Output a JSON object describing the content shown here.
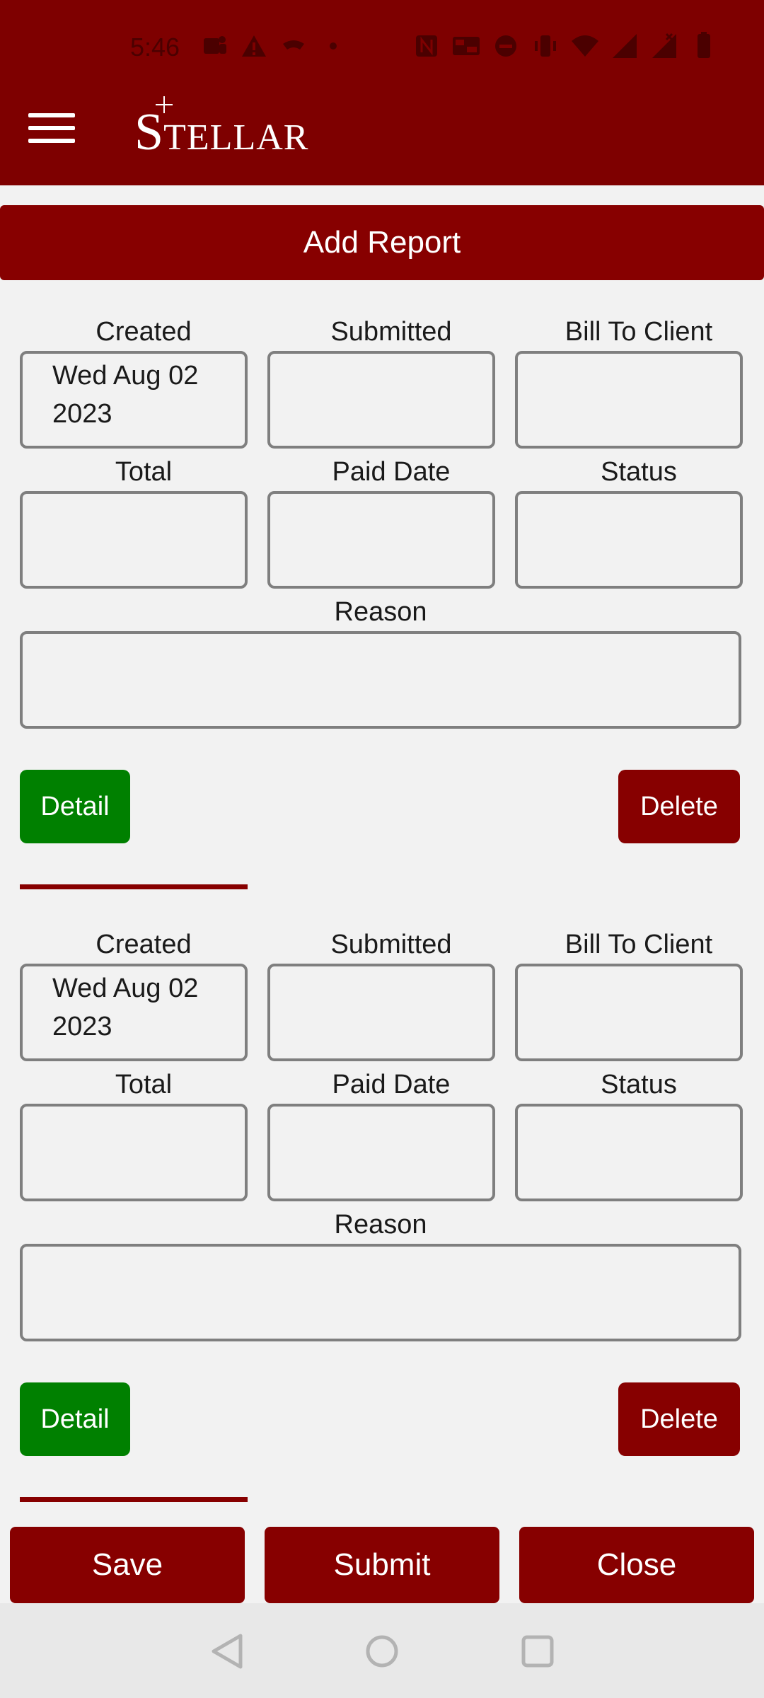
{
  "status_bar": {
    "time": "5:46",
    "icons": [
      "teams-icon",
      "warning-icon",
      "handshake-icon",
      "dot-icon",
      "nfc-icon",
      "volte-icon",
      "dnd-icon",
      "vibrate-icon",
      "wifi-icon",
      "signal-icon",
      "signal-x-icon",
      "battery-icon"
    ]
  },
  "header": {
    "brand_first": "S",
    "brand_rest": "TELLAR",
    "menu_icon": "hamburger-icon"
  },
  "add_report_label": "Add Report",
  "field_labels": {
    "created": "Created",
    "submitted": "Submitted",
    "bill_to_client": "Bill To Client",
    "total": "Total",
    "paid_date": "Paid Date",
    "status": "Status",
    "reason": "Reason"
  },
  "reports": [
    {
      "created_line1": "Wed Aug 02",
      "created_line2": "2023",
      "submitted": "",
      "bill_to_client": "",
      "total": "",
      "paid_date": "",
      "status": "",
      "reason": "",
      "detail_label": "Detail",
      "delete_label": "Delete"
    },
    {
      "created_line1": "Wed Aug 02",
      "created_line2": "2023",
      "submitted": "",
      "bill_to_client": "",
      "total": "",
      "paid_date": "",
      "status": "",
      "reason": "",
      "detail_label": "Detail",
      "delete_label": "Delete"
    }
  ],
  "actions": {
    "save": "Save",
    "submit": "Submit",
    "close": "Close"
  },
  "colors": {
    "brand": "#7e0000",
    "button_dark_red": "#870000",
    "detail_green": "#008000",
    "background": "#f2f2f2"
  }
}
